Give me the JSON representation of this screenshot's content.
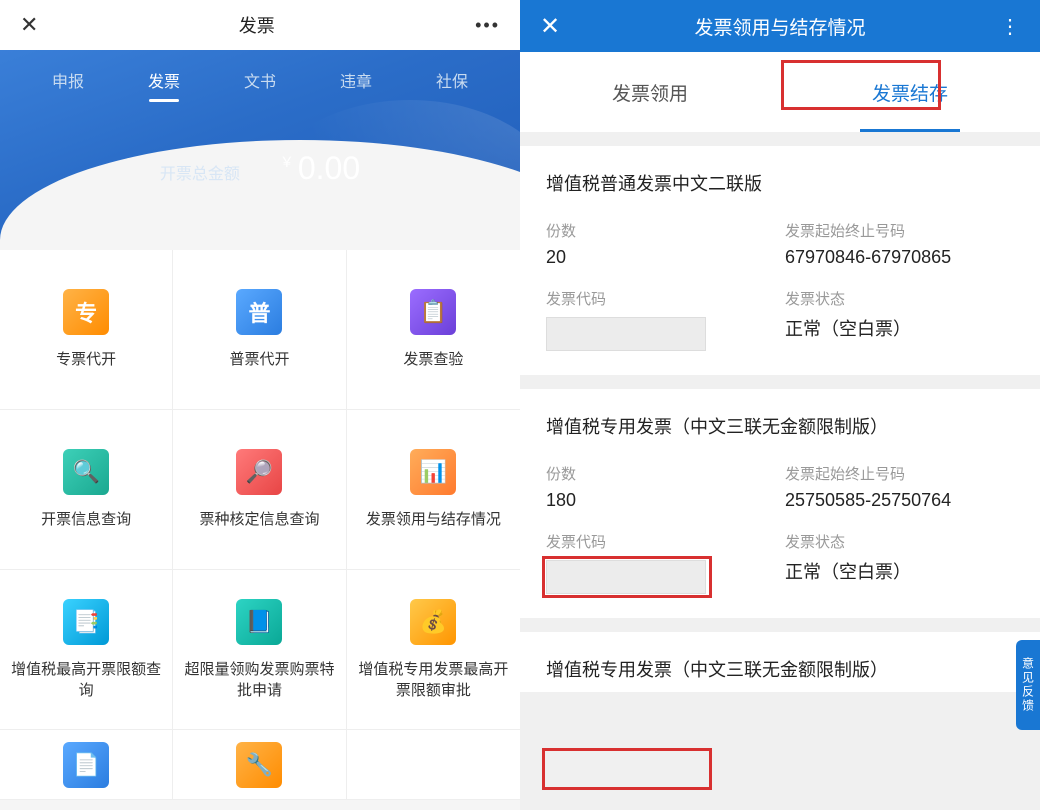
{
  "left": {
    "header": {
      "title": "发票"
    },
    "tabs": [
      "申报",
      "发票",
      "文书",
      "违章",
      "社保"
    ],
    "active_tab_index": 1,
    "amount": {
      "label": "开票总金额",
      "currency": "￥",
      "value": "0.00"
    },
    "grid": [
      {
        "label": "专票代开",
        "icon": "专",
        "cls": "ico-orange"
      },
      {
        "label": "普票代开",
        "icon": "普",
        "cls": "ico-blue"
      },
      {
        "label": "发票查验",
        "icon": "📋",
        "cls": "ico-purple"
      },
      {
        "label": "开票信息查询",
        "icon": "🔍",
        "cls": "ico-teal"
      },
      {
        "label": "票种核定信息查询",
        "icon": "🔎",
        "cls": "ico-red"
      },
      {
        "label": "发票领用与结存情况",
        "icon": "📊",
        "cls": "ico-orange2"
      },
      {
        "label": "增值税最高开票限额查询",
        "icon": "📑",
        "cls": "ico-cyan"
      },
      {
        "label": "超限量领购发票购票特批申请",
        "icon": "📘",
        "cls": "ico-teal2"
      },
      {
        "label": "增值税专用发票最高开票限额审批",
        "icon": "💰",
        "cls": "ico-amber"
      }
    ],
    "row4": [
      {
        "icon": "📄",
        "cls": "ico-blue"
      },
      {
        "icon": "🔧",
        "cls": "ico-orange"
      }
    ]
  },
  "right": {
    "header": {
      "title": "发票领用与结存情况"
    },
    "tabs": [
      "发票领用",
      "发票结存"
    ],
    "active_tab_index": 1,
    "cards": [
      {
        "title": "增值税普通发票中文二联版",
        "fields": {
          "count_label": "份数",
          "count": "20",
          "range_label": "发票起始终止号码",
          "range": "67970846-67970865",
          "code_label": "发票代码",
          "status_label": "发票状态",
          "status": "正常（空白票）"
        }
      },
      {
        "title": "增值税专用发票（中文三联无金额限制版）",
        "fields": {
          "count_label": "份数",
          "count": "180",
          "range_label": "发票起始终止号码",
          "range": "25750585-25750764",
          "code_label": "发票代码",
          "status_label": "发票状态",
          "status": "正常（空白票）"
        }
      },
      {
        "title": "增值税专用发票（中文三联无金额限制版）"
      }
    ],
    "feedback_label": "意见反馈"
  }
}
